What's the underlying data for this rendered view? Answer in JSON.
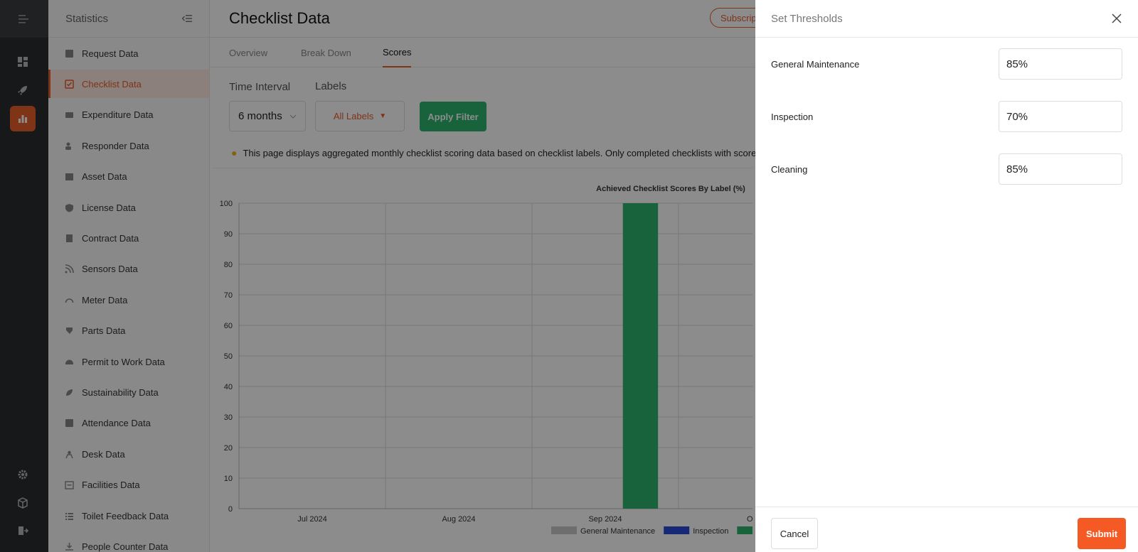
{
  "sidebar": {
    "title": "Statistics",
    "items": [
      {
        "label": "Request Data",
        "icon": "request-icon",
        "active": false
      },
      {
        "label": "Checklist Data",
        "icon": "checklist-icon",
        "active": true
      },
      {
        "label": "Expenditure Data",
        "icon": "expenditure-icon",
        "active": false
      },
      {
        "label": "Responder Data",
        "icon": "responder-icon",
        "active": false
      },
      {
        "label": "Asset Data",
        "icon": "asset-icon",
        "active": false
      },
      {
        "label": "License Data",
        "icon": "license-icon",
        "active": false
      },
      {
        "label": "Contract Data",
        "icon": "contract-icon",
        "active": false
      },
      {
        "label": "Sensors Data",
        "icon": "sensors-icon",
        "active": false
      },
      {
        "label": "Meter Data",
        "icon": "meter-icon",
        "active": false
      },
      {
        "label": "Parts Data",
        "icon": "parts-icon",
        "active": false
      },
      {
        "label": "Permit to Work Data",
        "icon": "permit-icon",
        "active": false
      },
      {
        "label": "Sustainability Data",
        "icon": "sustainability-icon",
        "active": false
      },
      {
        "label": "Attendance Data",
        "icon": "attendance-icon",
        "active": false
      },
      {
        "label": "Desk Data",
        "icon": "desk-icon",
        "active": false
      },
      {
        "label": "Facilities Data",
        "icon": "facilities-icon",
        "active": false
      },
      {
        "label": "Toilet Feedback Data",
        "icon": "toilet-feedback-icon",
        "active": false
      },
      {
        "label": "People Counter Data",
        "icon": "people-counter-icon",
        "active": false
      }
    ]
  },
  "header": {
    "title": "Checklist Data",
    "subscribe_label": "Subscript"
  },
  "tabs": [
    {
      "label": "Overview",
      "active": false
    },
    {
      "label": "Break Down",
      "active": false
    },
    {
      "label": "Scores",
      "active": true
    }
  ],
  "filters": {
    "time_interval_label": "Time Interval",
    "time_interval_value": "6 months",
    "labels_label": "Labels",
    "labels_value": "All Labels",
    "apply_label": "Apply Filter"
  },
  "info_text": "This page displays aggregated monthly checklist scoring data based on checklist labels. Only completed checklists with scores are",
  "chart_data": {
    "type": "bar",
    "title": "Achieved Checklist Scores By Label (%)",
    "categories": [
      "Jul 2024",
      "Aug 2024",
      "Sep 2024",
      "Oc"
    ],
    "ylim": [
      0,
      100
    ],
    "yticks": [
      "100",
      "90",
      "80",
      "70",
      "60",
      "50",
      "40",
      "30",
      "20",
      "10",
      "0"
    ],
    "series": [
      {
        "name": "General Maintenance",
        "color": "#c8c8c8",
        "values": [
          0,
          0,
          0,
          0
        ]
      },
      {
        "name": "Inspection",
        "color": "#2a4bd7",
        "values": [
          0,
          0,
          0,
          0
        ]
      },
      {
        "name": "",
        "color": "#2db36e",
        "values": [
          0,
          0,
          100,
          0
        ]
      }
    ]
  },
  "drawer": {
    "title": "Set Thresholds",
    "rows": [
      {
        "label": "General Maintenance",
        "value": "85%"
      },
      {
        "label": "Inspection",
        "value": "70%"
      },
      {
        "label": "Cleaning",
        "value": "85%"
      }
    ],
    "cancel_label": "Cancel",
    "submit_label": "Submit"
  }
}
